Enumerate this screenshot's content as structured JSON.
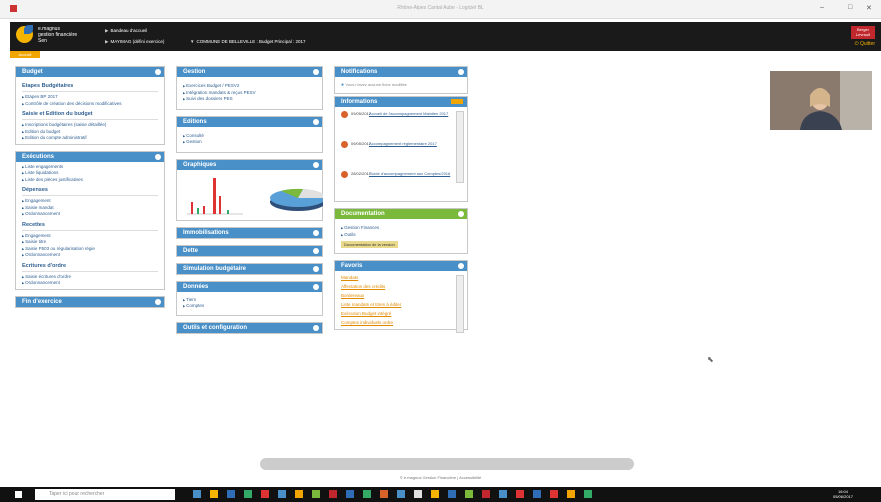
{
  "window": {
    "title": "Rhône-Alpes Cantal Aube - Logiciel BL"
  },
  "brand": {
    "line1": "e.magnus",
    "line2": "gestion financière",
    "line3": "Sen"
  },
  "topbar": {
    "btn1": "Bandeau d'accueil",
    "btn2": "MAYIMAG (défini exercice)",
    "context": "COMMUNE DE BELLEVILLE : Budget Principal : 2017",
    "red_btn": "Berger Levrault",
    "quit": "Quitter"
  },
  "subtab": {
    "label": "Accueil"
  },
  "budget": {
    "title": "Budget",
    "sec1": "Etapes Budgétaires",
    "sec1_items": [
      "Etapes BP 2017",
      "Contrôle de création des décisions modificatives"
    ],
    "sec2": "Saisie et Edition du budget",
    "sec2_items": [
      "Inscriptions budgétaires (saisie détaillée)",
      "Edition du budget",
      "Edition du compte administratif"
    ]
  },
  "execution": {
    "title": "Exécutions",
    "items0": [
      "Liste engagements",
      "Liste liquidations",
      "Liste des pièces justificatives"
    ],
    "sec1": "Dépenses",
    "sec1_items": [
      "Engagement",
      "Saisie mandat",
      "Ordonnancement"
    ],
    "sec2": "Recettes",
    "sec2_items": [
      "Engagement",
      "Saisie titre",
      "Saisie P503 ou régularisation régie",
      "Ordonnancement"
    ],
    "sec3": "Ecritures d'ordre",
    "sec3_items": [
      "Saisie écritures d'ordre",
      "Ordonnancement"
    ]
  },
  "fin_exercice": {
    "title": "Fin d'exercice"
  },
  "gestion": {
    "title": "Gestion",
    "items": [
      "Exercices Budget / PESV2",
      "Intégration mandats & reçus PESV",
      "Suivi des dossiers PES"
    ]
  },
  "editions": {
    "title": "Editions",
    "items": [
      "Consulté",
      "Gestion"
    ]
  },
  "graphiques": {
    "title": "Graphiques"
  },
  "immob": {
    "title": "Immobilisations"
  },
  "dette": {
    "title": "Dette"
  },
  "simulation": {
    "title": "Simulation budgétaire"
  },
  "donnees": {
    "title": "Données",
    "items": [
      "Tiers",
      "Comptes"
    ]
  },
  "outils": {
    "title": "Outils et configuration"
  },
  "notifications": {
    "title": "Notifications",
    "text": "Vous n'avez aucune fiche modifiée"
  },
  "informations": {
    "title": "Informations",
    "items": [
      {
        "date": "09/05/2017",
        "text": "Accueil de l'accompagnement Maintien 2017"
      },
      {
        "date": "09/05/2017",
        "text": "Accompagnement réglementaire 2017"
      },
      {
        "date": "28/02/2017",
        "text": "Guide d'accompagnement aux Comptes/2016"
      }
    ]
  },
  "documentation": {
    "title": "Documentation",
    "items": [
      "Gestion Finances",
      "Outils"
    ],
    "btn": "Documentation de la version"
  },
  "favoris": {
    "title": "Favoris",
    "items": [
      "Mandats",
      "Affectation des crédits",
      "Bordereaux",
      "Liste mandats et titres à éditer",
      "Exécution Budget intégré",
      "Comptes individuels ordre"
    ]
  },
  "footer": {
    "text": "© e.magnus Gestion Financière | Accessibilité"
  },
  "taskbar": {
    "search": "Taper ici pour rechercher",
    "time": "16:04",
    "date": "05/06/2017"
  }
}
